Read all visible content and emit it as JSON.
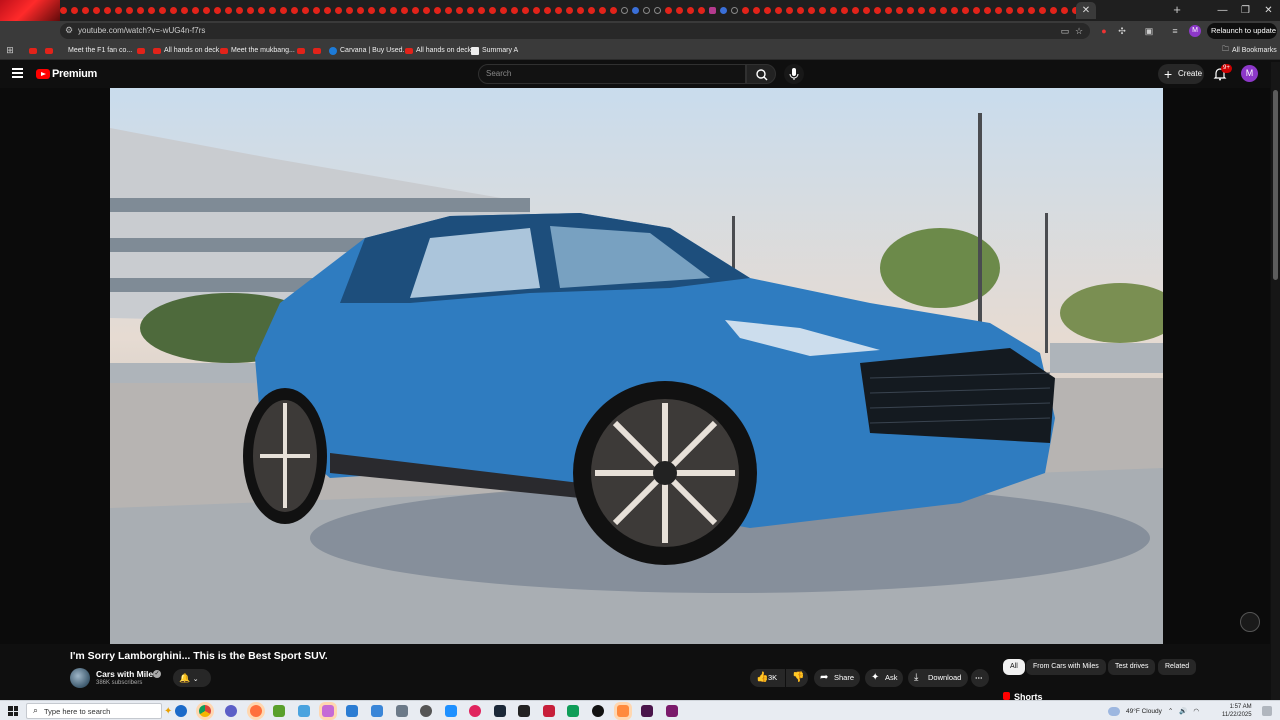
{
  "browser": {
    "url": "youtube.com/watch?v=-wUG4n-f7rs",
    "relaunch_label": "Relaunch to update",
    "profile_initial": "M",
    "bookmarks": [
      {
        "label": "Meet the F1 fan co...",
        "icon": "youtube-icon"
      },
      {
        "label": "All hands on deck",
        "icon": "youtube-icon"
      },
      {
        "label": "Meet the mukbang...",
        "icon": "youtube-icon"
      },
      {
        "label": "Carvana | Buy Used...",
        "icon": "carvana-icon"
      },
      {
        "label": "All hands on deck",
        "icon": "youtube-icon"
      },
      {
        "label": "Summary A",
        "icon": "summary-icon"
      }
    ],
    "all_bookmarks_label": "All Bookmarks"
  },
  "youtube": {
    "logo_text": "Premium",
    "search_placeholder": "Search",
    "create_label": "Create",
    "notification_count": "9+",
    "account_initial": "M"
  },
  "video": {
    "title": "I'm Sorry Lamborghini... This is the Best Sport SUV.",
    "channel_name": "Cars with Miles",
    "subscribers": "386K subscribers",
    "like_count": "3K",
    "share_label": "Share",
    "ask_label": "Ask",
    "download_label": "Download",
    "more_label": "⋯"
  },
  "chips": [
    "All",
    "From Cars with Miles",
    "Test drives",
    "Related"
  ],
  "shorts_label": "Shorts",
  "taskbar": {
    "search_placeholder": "Type here to search",
    "weather": "49°F  Cloudy",
    "time": "1:57 AM",
    "date": "11/22/2025"
  },
  "colors": {
    "brand_red": "#ff0000",
    "background": "#0f0f0f",
    "pill": "#272727",
    "avatar_purple": "#8d38c9"
  }
}
